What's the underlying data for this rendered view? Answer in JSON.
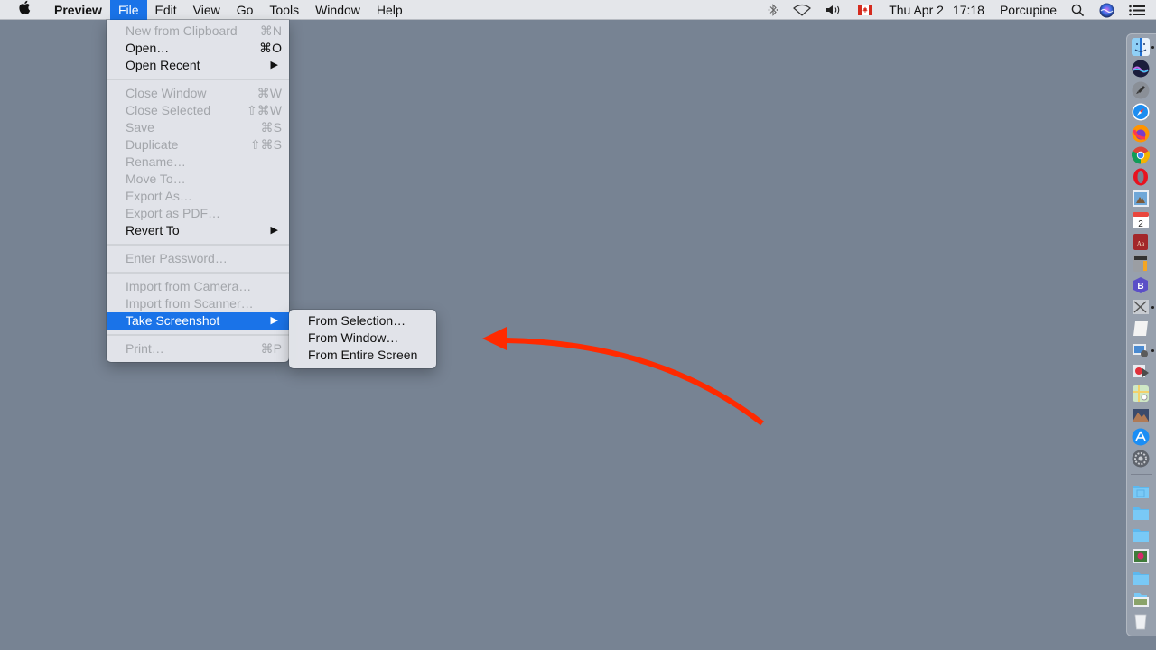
{
  "menubar": {
    "apple_icon": "apple-logo",
    "app_name": "Preview",
    "menus": [
      "File",
      "Edit",
      "View",
      "Go",
      "Tools",
      "Window",
      "Help"
    ],
    "active_menu": "File",
    "status": {
      "icons": [
        "bluetooth-icon",
        "wifi-icon",
        "volume-icon",
        "canada-flag-input-icon"
      ],
      "date": "Thu Apr 2",
      "time": "17:18",
      "user": "Porcupine",
      "right_icons": [
        "spotlight-search-icon",
        "siri-icon",
        "notification-center-icon"
      ]
    }
  },
  "file_menu": {
    "items": [
      {
        "label": "New from Clipboard",
        "shortcut": "⌘N",
        "enabled": false
      },
      {
        "label": "Open…",
        "shortcut": "⌘O",
        "enabled": true
      },
      {
        "label": "Open Recent",
        "submenu": true,
        "enabled": true
      },
      {
        "separator": true
      },
      {
        "label": "Close Window",
        "shortcut": "⌘W",
        "enabled": false
      },
      {
        "label": "Close Selected",
        "shortcut": "⇧⌘W",
        "enabled": false
      },
      {
        "label": "Save",
        "shortcut": "⌘S",
        "enabled": false
      },
      {
        "label": "Duplicate",
        "shortcut": "⇧⌘S",
        "enabled": false
      },
      {
        "label": "Rename…",
        "enabled": false
      },
      {
        "label": "Move To…",
        "enabled": false
      },
      {
        "label": "Export As…",
        "enabled": false
      },
      {
        "label": "Export as PDF…",
        "enabled": false
      },
      {
        "label": "Revert To",
        "submenu": true,
        "enabled": true
      },
      {
        "separator": true
      },
      {
        "label": "Enter Password…",
        "enabled": false
      },
      {
        "separator": true
      },
      {
        "label": "Import from Camera…",
        "enabled": false
      },
      {
        "label": "Import from Scanner…",
        "enabled": false
      },
      {
        "label": "Take Screenshot",
        "submenu": true,
        "enabled": true,
        "highlighted": true
      },
      {
        "separator": true
      },
      {
        "label": "Print…",
        "shortcut": "⌘P",
        "enabled": false
      }
    ],
    "submenu_arrow": "▶"
  },
  "screenshot_submenu": {
    "items": [
      "From Selection…",
      "From Window…",
      "From Entire Screen"
    ]
  },
  "annotation": {
    "type": "curved-arrow",
    "color": "#ff2a00",
    "points_to": "screenshot_submenu"
  },
  "dock": {
    "items": [
      {
        "name": "finder",
        "running": true
      },
      {
        "name": "siri"
      },
      {
        "name": "launchpad"
      },
      {
        "name": "safari"
      },
      {
        "name": "firefox"
      },
      {
        "name": "chrome"
      },
      {
        "name": "opera"
      },
      {
        "name": "preview-mail"
      },
      {
        "name": "calendar",
        "label": "2"
      },
      {
        "name": "dictionary",
        "label": "Aa"
      },
      {
        "name": "calculator"
      },
      {
        "name": "bbedit"
      },
      {
        "name": "screenshot-tool",
        "running": true
      },
      {
        "name": "textedit"
      },
      {
        "name": "preview",
        "running": true
      },
      {
        "name": "image-capture"
      },
      {
        "name": "maps"
      },
      {
        "name": "photos"
      },
      {
        "name": "app-store"
      },
      {
        "name": "system-preferences"
      },
      {
        "separator": true
      },
      {
        "name": "folder-applications"
      },
      {
        "name": "folder-documents"
      },
      {
        "name": "folder-downloads"
      },
      {
        "name": "photo-stack"
      },
      {
        "name": "folder-generic"
      },
      {
        "name": "folder-pictures"
      },
      {
        "name": "trash"
      }
    ]
  }
}
